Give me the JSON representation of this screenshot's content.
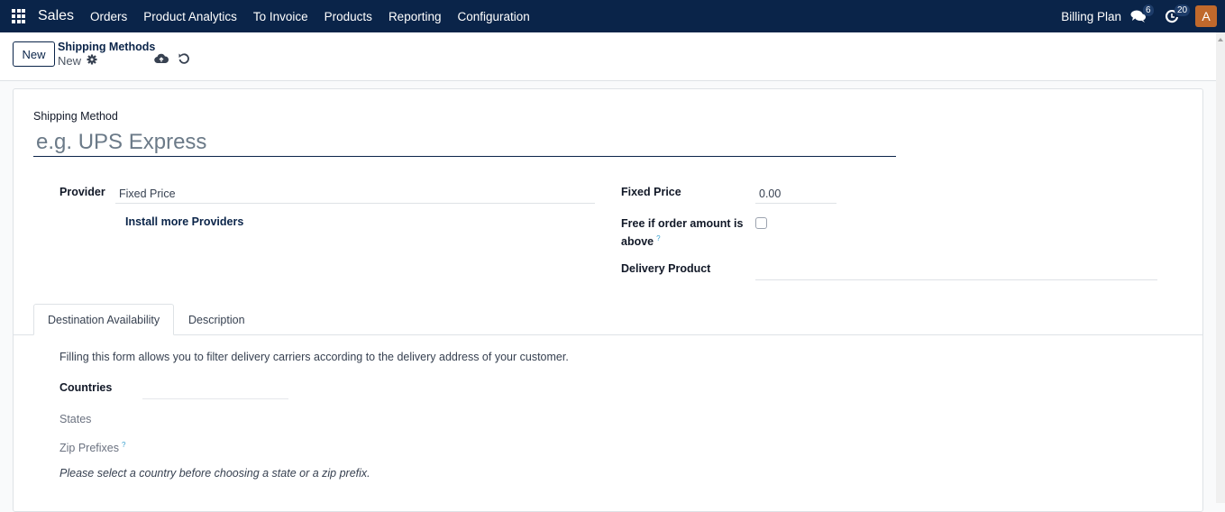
{
  "navbar": {
    "app_name": "Sales",
    "menu": [
      "Orders",
      "Product Analytics",
      "To Invoice",
      "Products",
      "Reporting",
      "Configuration"
    ],
    "company": "Billing Plan",
    "messages_count": "6",
    "activities_count": "20",
    "avatar_initial": "A",
    "avatar_color": "#c0692c",
    "bg_color": "#0a2449"
  },
  "control_panel": {
    "new_button": "New",
    "breadcrumb": "Shipping Methods",
    "record_name": "New"
  },
  "form": {
    "name_label": "Shipping Method",
    "name_placeholder": "e.g. UPS Express",
    "provider_label": "Provider",
    "provider_value": "Fixed Price",
    "install_providers": "Install more Providers",
    "fixed_price_label": "Fixed Price",
    "fixed_price_value": "0.00",
    "free_if_label_line1": "Free if order amount is",
    "free_if_label_line2": "above",
    "free_if_checked": false,
    "delivery_product_label": "Delivery Product",
    "delivery_product_value": "",
    "help_marker": "?"
  },
  "tabs": [
    {
      "label": "Destination Availability",
      "active": true
    },
    {
      "label": "Description",
      "active": false
    }
  ],
  "destination": {
    "intro": "Filling this form allows you to filter delivery carriers according to the delivery address of your customer.",
    "countries_label": "Countries",
    "states_label": "States",
    "zip_label": "Zip Prefixes",
    "note": "Please select a country before choosing a state or a zip prefix."
  }
}
